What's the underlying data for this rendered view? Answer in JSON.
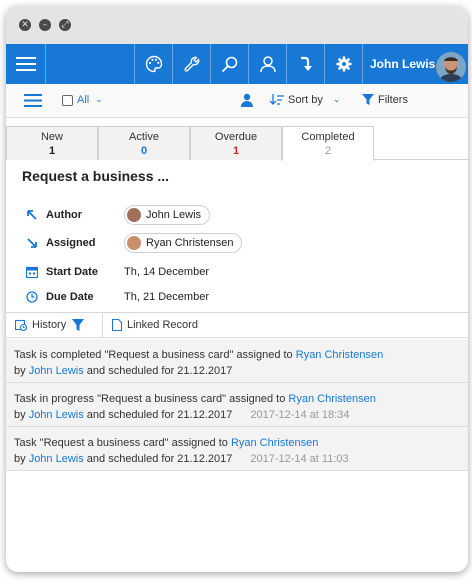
{
  "colors": {
    "accent": "#1878d5",
    "overdue": "#d9232a"
  },
  "window_controls": [
    "close-icon",
    "minimize-icon",
    "restore-icon"
  ],
  "appbar": {
    "icons": [
      "menu-icon",
      "palette-icon",
      "wrench-icon",
      "search-icon",
      "user-icon",
      "redirect-icon",
      "gear-icon"
    ],
    "user_name": "John Lewis"
  },
  "toolbar": {
    "all_label": "All",
    "sort_label": "Sort by",
    "filters_label": "Filters"
  },
  "tabs": [
    {
      "label": "New",
      "count": "1"
    },
    {
      "label": "Active",
      "count": "0"
    },
    {
      "label": "Overdue",
      "count": "1"
    },
    {
      "label": "Completed",
      "count": "2"
    }
  ],
  "task": {
    "title": "Request a business ...",
    "fields": {
      "author_label": "Author",
      "author_value": "John Lewis",
      "assigned_label": "Assigned",
      "assigned_value": "Ryan Christensen",
      "start_label": "Start Date",
      "start_value": "Th, 14 December",
      "due_label": "Due Date",
      "due_value": "Th, 21 December"
    }
  },
  "history_bar": {
    "history_label": "History",
    "linked_label": "Linked Record"
  },
  "history": [
    {
      "prefix": "Task is completed \"Request a business card\" assigned to ",
      "assignee": "Ryan Christensen",
      "by": "by ",
      "author": "John Lewis",
      "suffix": " and scheduled for 21.12.2017",
      "timestamp": ""
    },
    {
      "prefix": "Task in progress \"Request a business card\" assigned to ",
      "assignee": "Ryan Christensen",
      "by": "by ",
      "author": "John Lewis",
      "suffix": " and scheduled for 21.12.2017",
      "timestamp": "2017-12-14 at 18:34"
    },
    {
      "prefix": "Task \"Request a business card\" assigned to ",
      "assignee": "Ryan Christensen",
      "by": "by ",
      "author": "John Lewis",
      "suffix": " and scheduled for 21.12.2017",
      "timestamp": "2017-12-14 at 11:03"
    }
  ]
}
